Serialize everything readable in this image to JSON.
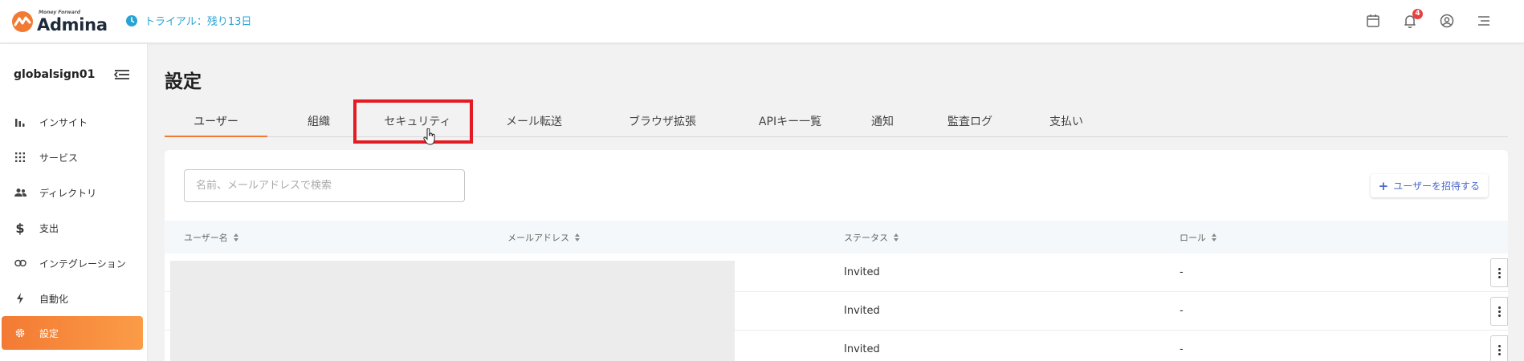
{
  "app": {
    "brand_sub": "Money Forward",
    "brand_name": "Admina",
    "trial_text": "トライアル：残り13日",
    "notification_count": "4"
  },
  "sidebar": {
    "org_name": "globalsign01",
    "items": [
      {
        "label": "インサイト",
        "icon": "bar-chart-icon"
      },
      {
        "label": "サービス",
        "icon": "grid-icon"
      },
      {
        "label": "ディレクトリ",
        "icon": "users-icon"
      },
      {
        "label": "支出",
        "icon": "dollar-icon"
      },
      {
        "label": "インテグレーション",
        "icon": "link-icon"
      },
      {
        "label": "自動化",
        "icon": "bolt-icon"
      },
      {
        "label": "設定",
        "icon": "gear-icon",
        "active": true
      }
    ]
  },
  "main": {
    "title": "設定",
    "tabs": [
      {
        "label": "ユーザー",
        "active": true
      },
      {
        "label": "組織"
      },
      {
        "label": "セキュリティ",
        "highlighted": true
      },
      {
        "label": "メール転送"
      },
      {
        "label": "ブラウザ拡張"
      },
      {
        "label": "APIキー一覧"
      },
      {
        "label": "通知"
      },
      {
        "label": "監査ログ"
      },
      {
        "label": "支払い"
      }
    ],
    "search_placeholder": "名前、メールアドレスで検索",
    "invite_label": "ユーザーを招待する",
    "table": {
      "columns": [
        "ユーザー名",
        "メールアドレス",
        "ステータス",
        "ロール"
      ],
      "rows": [
        {
          "status": "Invited",
          "role": "-"
        },
        {
          "status": "Invited",
          "role": "-"
        },
        {
          "status": "Invited",
          "role": "-"
        }
      ]
    }
  },
  "colors": {
    "accent": "#f37a33",
    "highlight": "#e31b23",
    "link": "#29a3d4",
    "invite": "#4a69c9"
  }
}
